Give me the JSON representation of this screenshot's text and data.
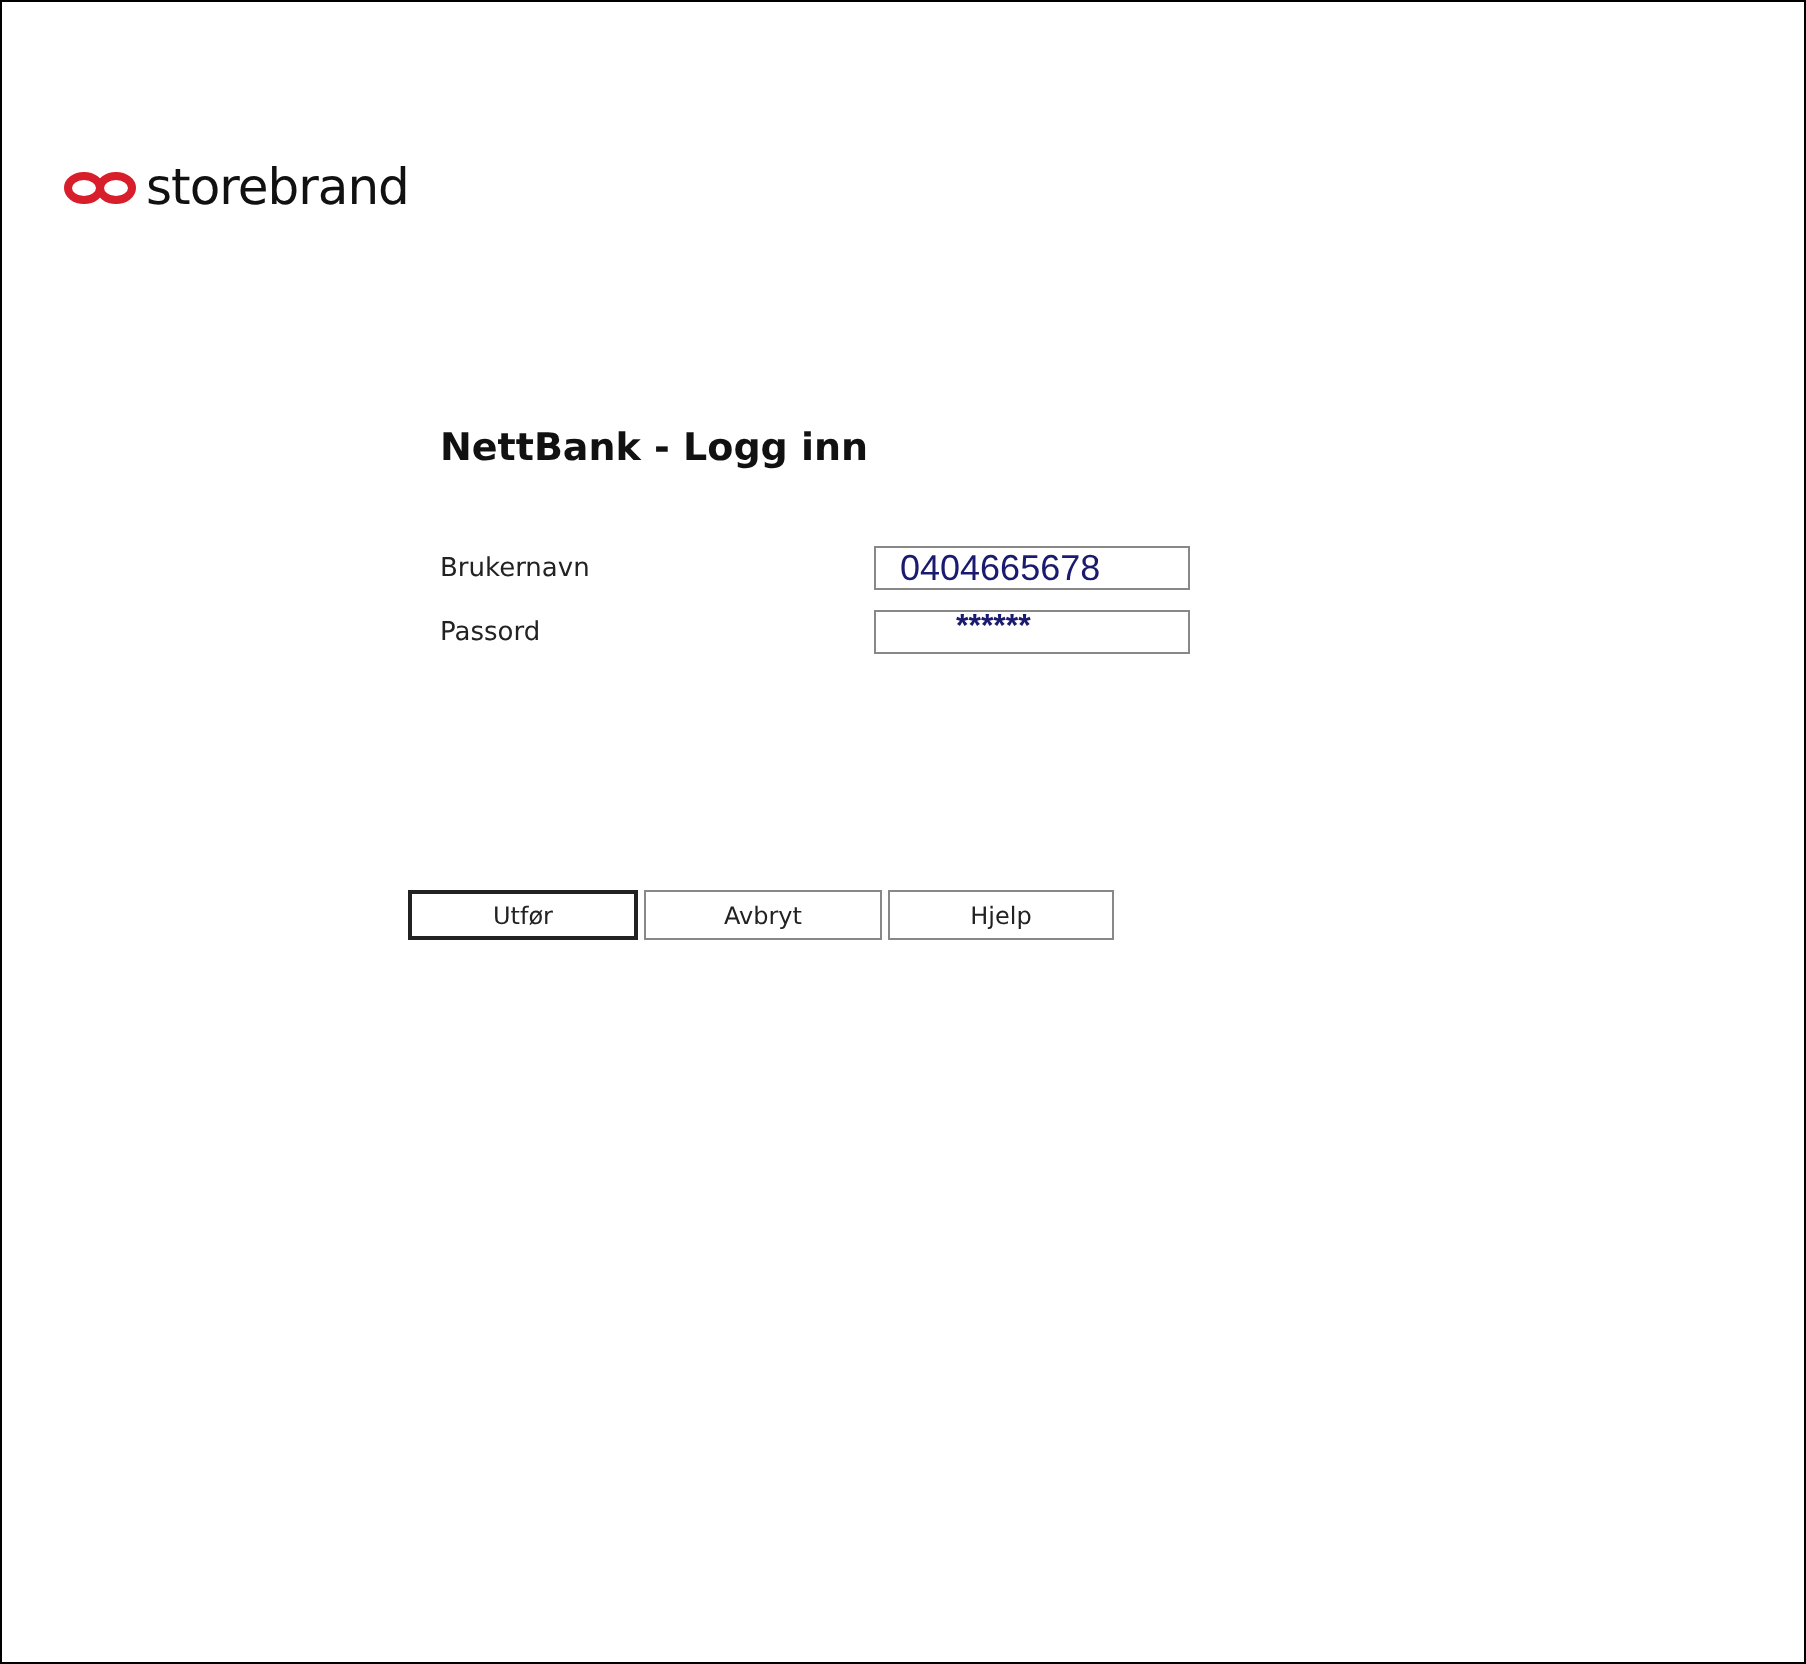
{
  "brand": {
    "name": "storebrand"
  },
  "title": "NettBank - Logg inn",
  "fields": [
    {
      "label": "Brukernavn",
      "value": "0404665678"
    },
    {
      "label": "Passord",
      "value": "******"
    }
  ],
  "buttons": [
    {
      "label": "Utfør",
      "default": true
    },
    {
      "label": "Avbryt",
      "default": false
    },
    {
      "label": "Hjelp",
      "default": false
    }
  ]
}
